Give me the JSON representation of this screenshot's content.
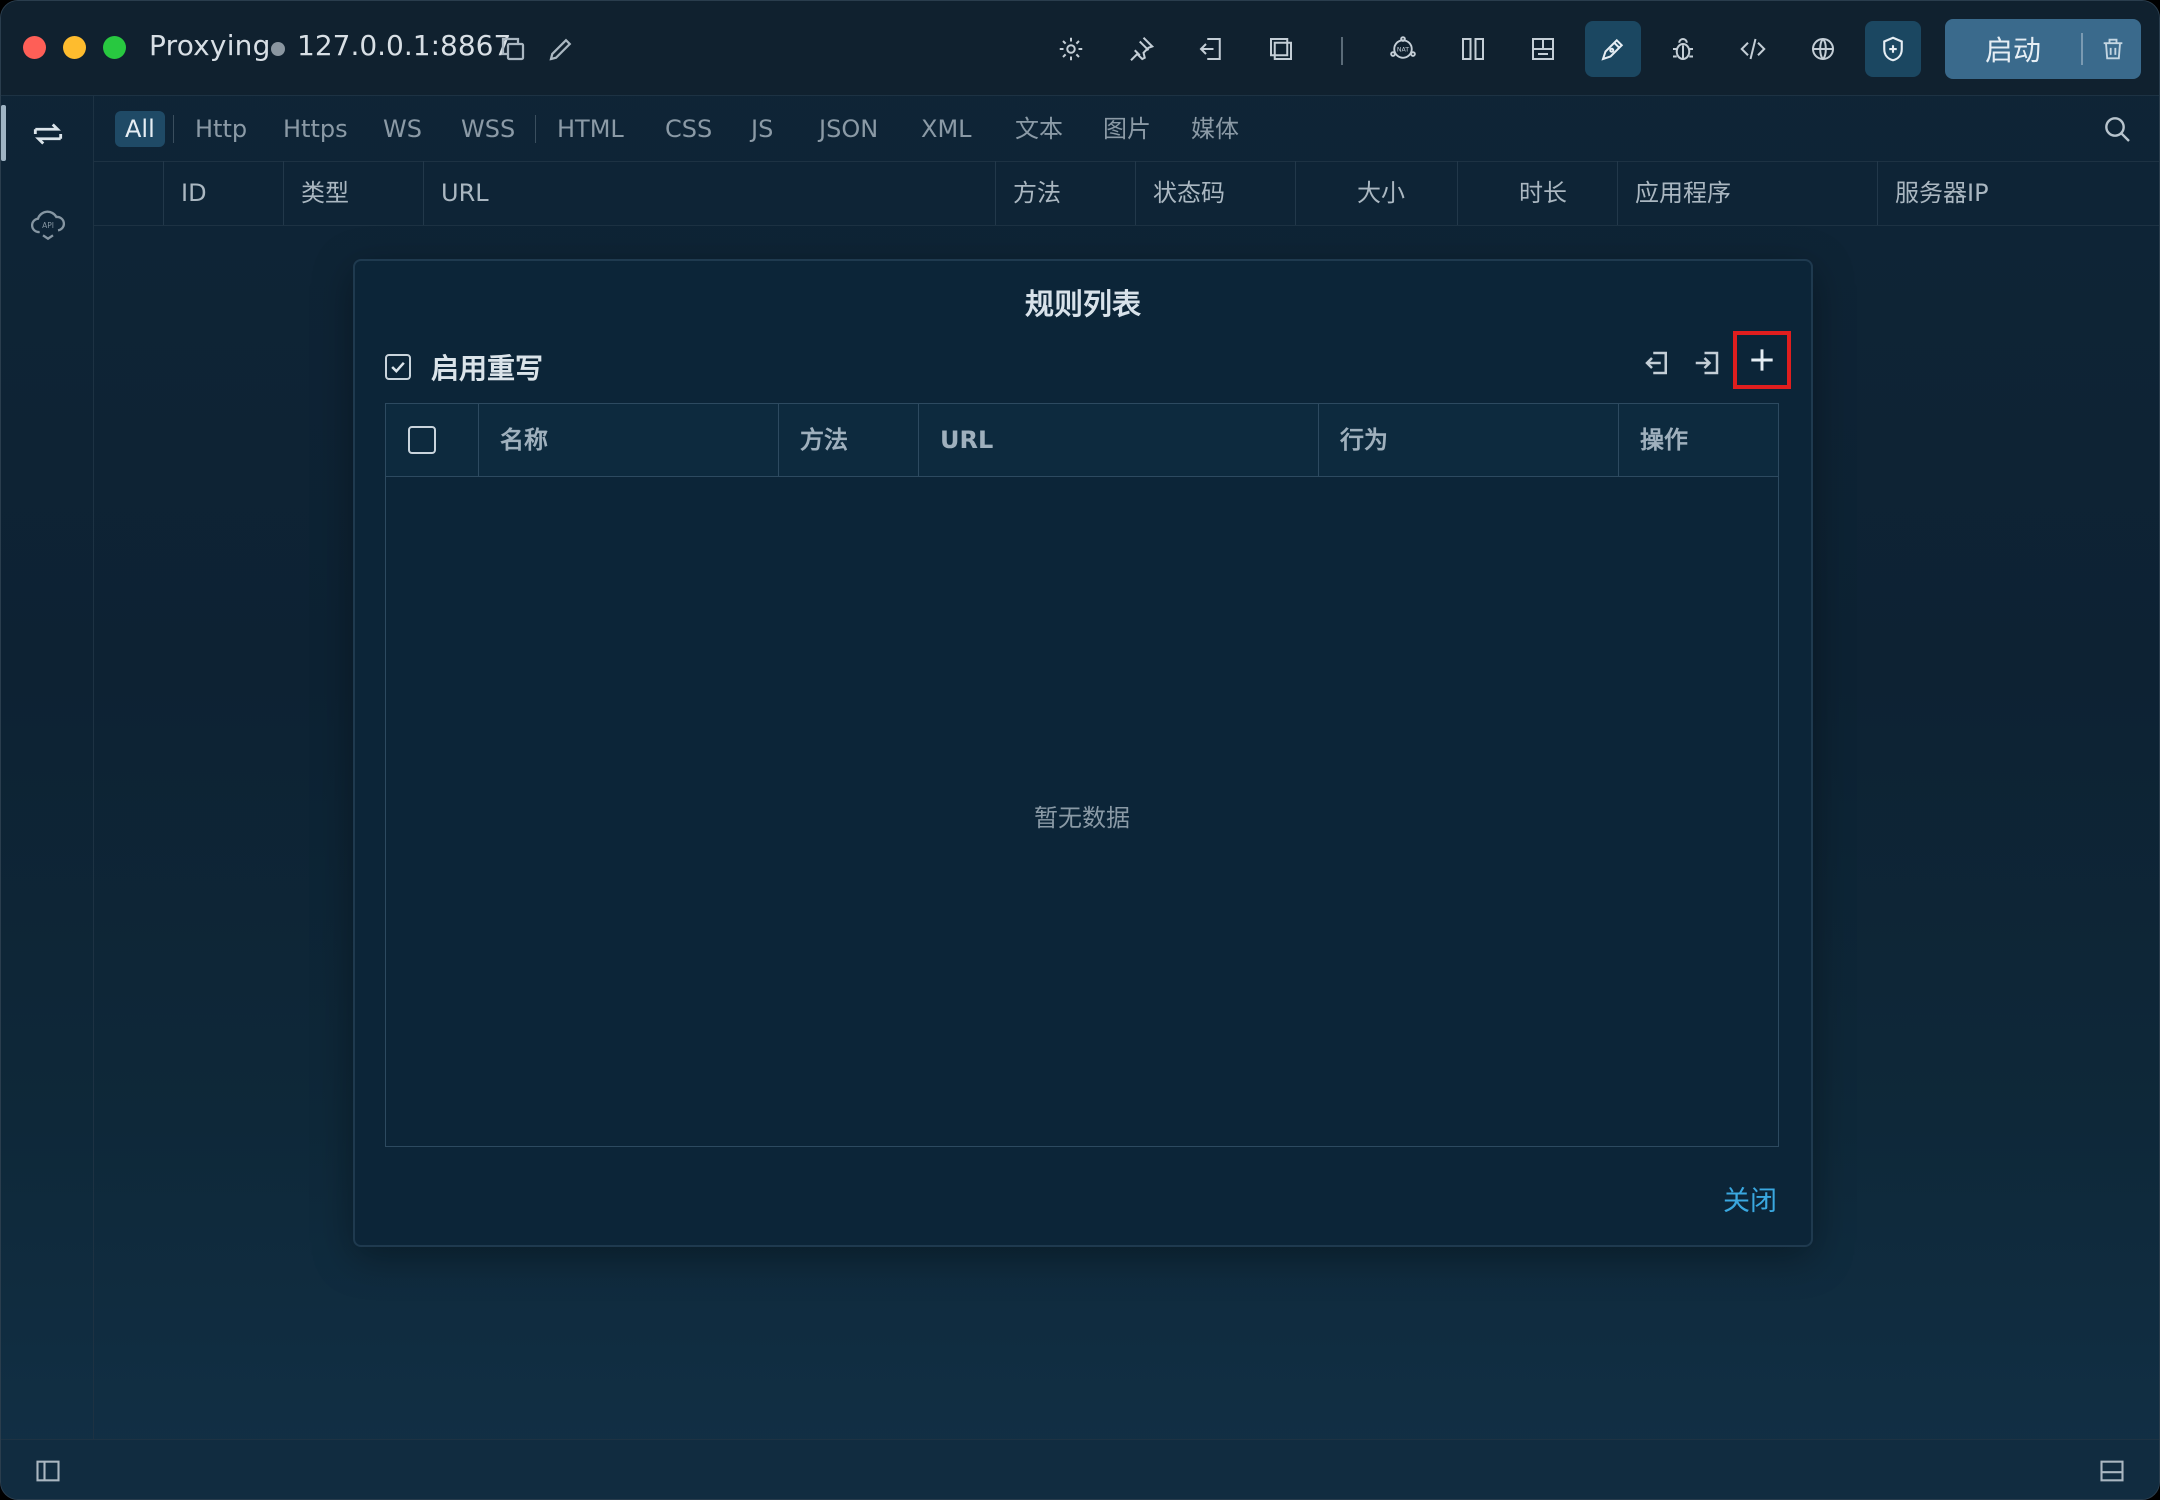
{
  "titlebar": {
    "app_name": "Proxying",
    "address": "127.0.0.1:8867",
    "start_label": "启动"
  },
  "toolbar_icons": [
    "gear-icon",
    "pin-icon",
    "exit-icon",
    "copy-window-icon",
    "nat-icon",
    "split-icon",
    "layout-icon",
    "pen-icon",
    "bug-icon",
    "code-icon",
    "globe-icon",
    "shield-icon",
    "trash-icon"
  ],
  "filters": [
    "All",
    "Http",
    "Https",
    "WS",
    "WSS",
    "HTML",
    "CSS",
    "JS",
    "JSON",
    "XML",
    "文本",
    "图片",
    "媒体"
  ],
  "columns": [
    "ID",
    "类型",
    "URL",
    "方法",
    "状态码",
    "大小",
    "时长",
    "应用程序",
    "服务器IP"
  ],
  "dialog": {
    "title": "规则列表",
    "enable_label": "启用重写",
    "enable_checked": true,
    "table_headers": {
      "name": "名称",
      "method": "方法",
      "url": "URL",
      "action": "行为",
      "ops": "操作"
    },
    "empty_text": "暂无数据",
    "close_label": "关闭"
  },
  "colors": {
    "accent": "#3aa8e0",
    "highlight_box": "#e01e1e",
    "active_tab": "#1f4a66"
  }
}
